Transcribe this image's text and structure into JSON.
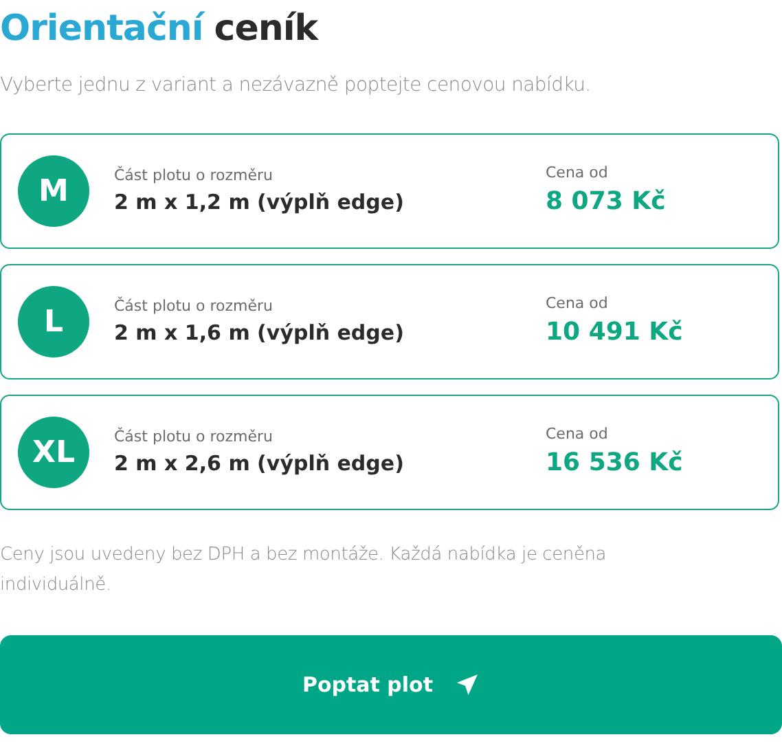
{
  "title": {
    "highlight": "Orientační",
    "rest": "ceník"
  },
  "subtitle": "Vyberte jednu z variant a nezávazně poptejte cenovou nabídku.",
  "variants": [
    {
      "size": "M",
      "label": "Část plotu o rozměru",
      "dimensions": "2 m x 1,2 m (výplň edge)",
      "price_label": "Cena od",
      "price": "8 073 Kč"
    },
    {
      "size": "L",
      "label": "Část plotu o rozměru",
      "dimensions": "2 m x 1,6 m (výplň edge)",
      "price_label": "Cena od",
      "price": "10 491 Kč"
    },
    {
      "size": "XL",
      "label": "Část plotu o rozměru",
      "dimensions": "2 m x 2,6 m (výplň edge)",
      "price_label": "Cena od",
      "price": "16 536 Kč"
    }
  ],
  "note": "Ceny jsou uvedeny bez DPH a bez montáže. Každá nabídka je ceněna individuálně.",
  "button": {
    "label": "Poptat plot"
  }
}
